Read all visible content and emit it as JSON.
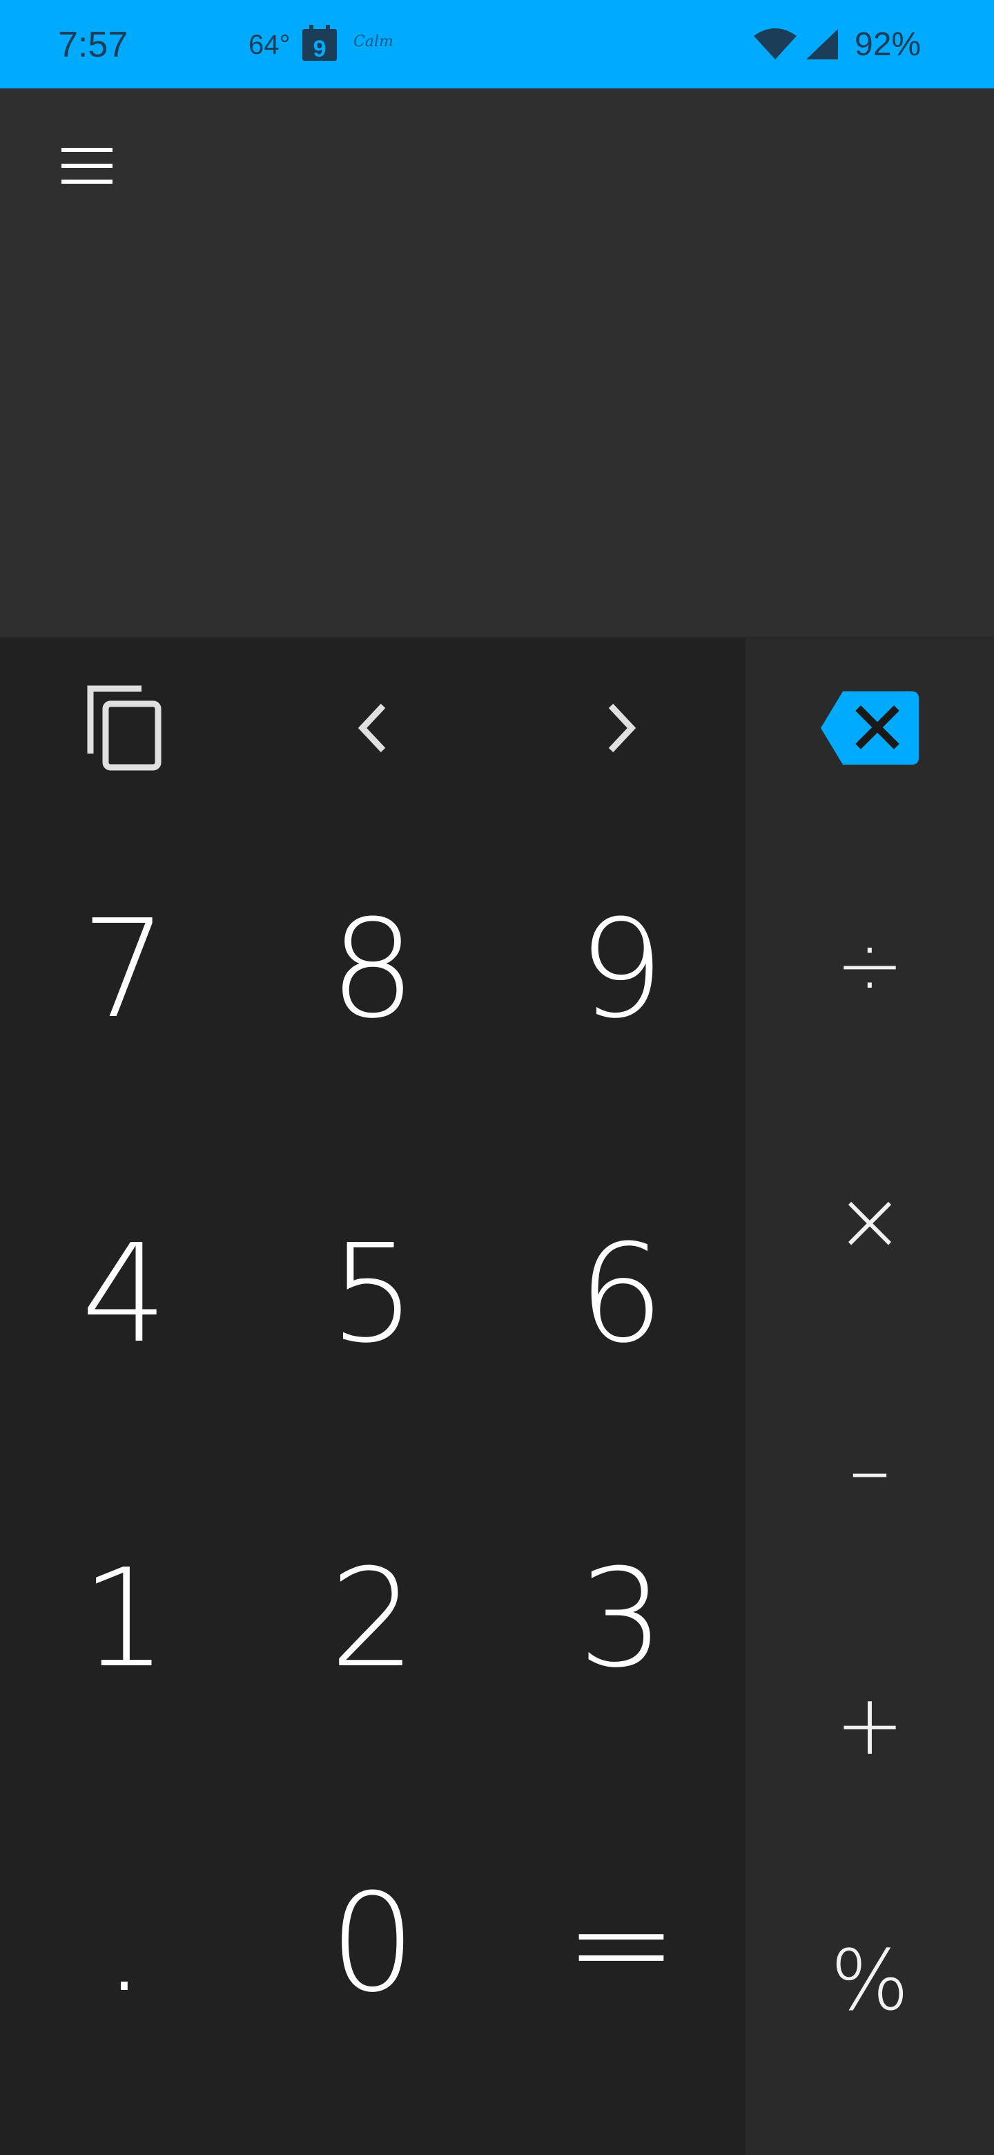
{
  "status_bar": {
    "time": "7:57",
    "temperature": "64°",
    "calendar_day": "9",
    "calm_label": "Calm",
    "battery": "92%",
    "background_color": "#00aaff"
  },
  "display": {
    "menu_icon": "menu-icon",
    "background_color": "#2f2f2f"
  },
  "tools": {
    "copy_icon": "copy-icon",
    "left_icon": "chevron-left-icon",
    "right_icon": "chevron-right-icon",
    "backspace_icon": "backspace-icon",
    "accent_color": "#00aaff"
  },
  "keypad": {
    "row1": [
      "7",
      "8",
      "9"
    ],
    "row2": [
      "4",
      "5",
      "6"
    ],
    "row3": [
      "1",
      "2",
      "3"
    ],
    "row4": [
      ".",
      "0",
      "="
    ],
    "background_color": "#212121"
  },
  "operators": {
    "divide": "÷",
    "multiply": "×",
    "minus": "–",
    "plus": "+",
    "percent": "%",
    "background_color": "#2a2a2a"
  }
}
